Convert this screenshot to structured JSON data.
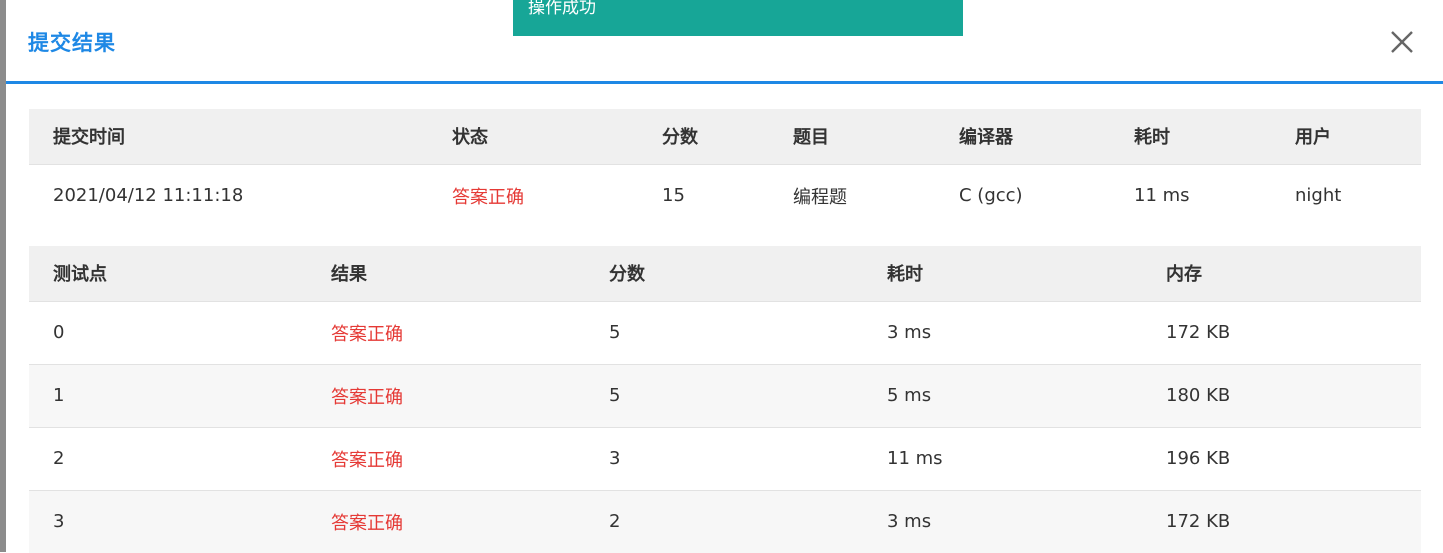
{
  "toast": {
    "message": "操作成功"
  },
  "modal": {
    "title": "提交结果"
  },
  "colors": {
    "accent": "#1e88e5",
    "toast_bg": "#17a697",
    "status_ok": "#e53935"
  },
  "summary": {
    "headers": [
      "提交时间",
      "状态",
      "分数",
      "题目",
      "编译器",
      "耗时",
      "用户"
    ],
    "row": {
      "submit_time": "2021/04/12 11:11:18",
      "status": "答案正确",
      "score": "15",
      "problem": "编程题",
      "compiler": "C (gcc)",
      "time": "11 ms",
      "user": "night"
    }
  },
  "cases": {
    "headers": [
      "测试点",
      "结果",
      "分数",
      "耗时",
      "内存"
    ],
    "rows": [
      {
        "id": "0",
        "result": "答案正确",
        "score": "5",
        "time": "3 ms",
        "memory": "172 KB"
      },
      {
        "id": "1",
        "result": "答案正确",
        "score": "5",
        "time": "5 ms",
        "memory": "180 KB"
      },
      {
        "id": "2",
        "result": "答案正确",
        "score": "3",
        "time": "11 ms",
        "memory": "196 KB"
      },
      {
        "id": "3",
        "result": "答案正确",
        "score": "2",
        "time": "3 ms",
        "memory": "172 KB"
      }
    ]
  },
  "icons": {
    "close": "close-icon"
  }
}
